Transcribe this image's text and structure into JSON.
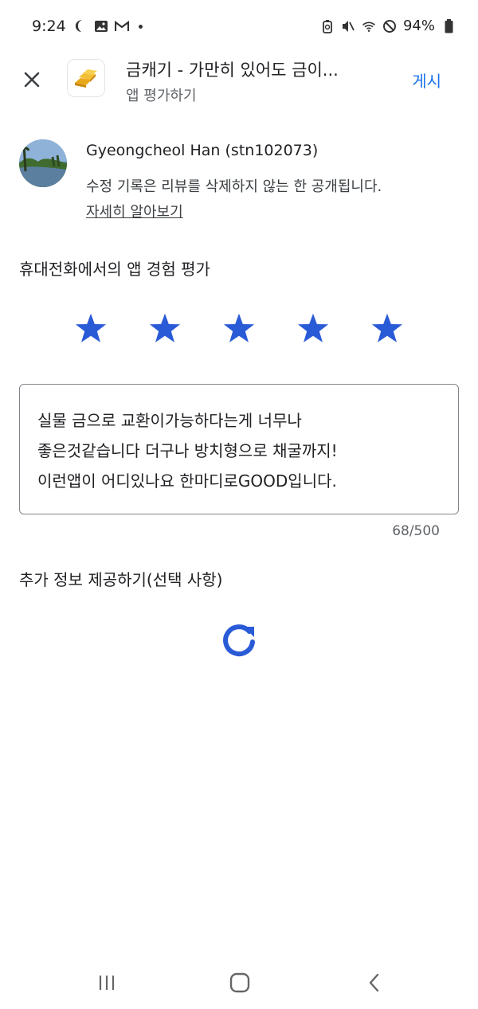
{
  "status_bar": {
    "time": "9:24",
    "battery": "94%",
    "left_icons": [
      "weather-icon",
      "gallery-icon",
      "gmail-icon",
      "notification-dot"
    ],
    "right_icons": [
      "battery-saver-icon",
      "mute-icon",
      "wifi-icon",
      "dnd-icon",
      "battery-icon"
    ]
  },
  "header": {
    "app_title": "금캐기 - 가만히 있어도 금이...",
    "subtitle": "앱 평가하기",
    "post_label": "게시"
  },
  "user": {
    "name": "Gyeongcheol Han (stn102073)",
    "notice": "수정 기록은 리뷰를 삭제하지 않는 한 공개됩니다.",
    "learn_more": "자세히 알아보기"
  },
  "rating": {
    "label": "휴대전화에서의 앱 경험 평가",
    "value": 5,
    "max": 5
  },
  "review": {
    "text": "실물 금으로 교환이가능하다는게 너무나\n좋은것같습니다 더구나 방치형으로 채굴까지!\n이런앱이 어디있나요 한마디로GOOD입니다.",
    "count": "68/500"
  },
  "extra": {
    "label": "추가 정보 제공하기(선택 사항)"
  },
  "colors": {
    "accent": "#1a73e8",
    "star": "#2a5bd7"
  }
}
